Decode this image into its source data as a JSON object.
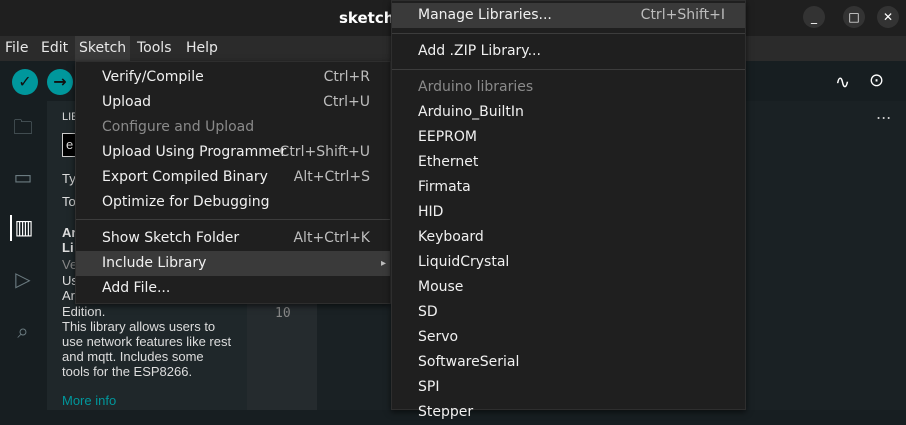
{
  "window": {
    "title": "sketch_",
    "minimize": "_",
    "maximize": "□",
    "close": "✕"
  },
  "menubar": [
    "File",
    "Edit",
    "Sketch",
    "Tools",
    "Help"
  ],
  "sketch_menu": [
    {
      "label": "Verify/Compile",
      "shortcut": "Ctrl+R"
    },
    {
      "label": "Upload",
      "shortcut": "Ctrl+U"
    },
    {
      "label": "Configure and Upload",
      "shortcut": ""
    },
    {
      "label": "Upload Using Programmer",
      "shortcut": "Ctrl+Shift+U"
    },
    {
      "label": "Export Compiled Binary",
      "shortcut": "Alt+Ctrl+S"
    },
    {
      "label": "Optimize for Debugging",
      "shortcut": ""
    },
    {
      "label": "Show Sketch Folder",
      "shortcut": "Alt+Ctrl+K"
    },
    {
      "label": "Include Library",
      "shortcut": "▸"
    },
    {
      "label": "Add File...",
      "shortcut": ""
    }
  ],
  "library_menu": {
    "manage": {
      "label": "Manage Libraries...",
      "shortcut": "Ctrl+Shift+I"
    },
    "add_zip": "Add .ZIP Library...",
    "section": "Arduino libraries",
    "items": [
      "Arduino_BuiltIn",
      "EEPROM",
      "Ethernet",
      "Firmata",
      "HID",
      "Keyboard",
      "LiquidCrystal",
      "Mouse",
      "SD",
      "Servo",
      "SoftwareSerial",
      "SPI",
      "Stepper"
    ]
  },
  "panel": {
    "header": "LIE",
    "search": "e",
    "type": "Ty",
    "topic": "To",
    "lib_title": "Ar Li",
    "version": "Ve",
    "desc_partial": "Us Ar",
    "description": "Edition.\nThis library allows users to use network features like rest and mqtt. Includes some tools for the ESP8266.",
    "more_info": "More info"
  },
  "editor": {
    "line": "10",
    "more": "..."
  }
}
